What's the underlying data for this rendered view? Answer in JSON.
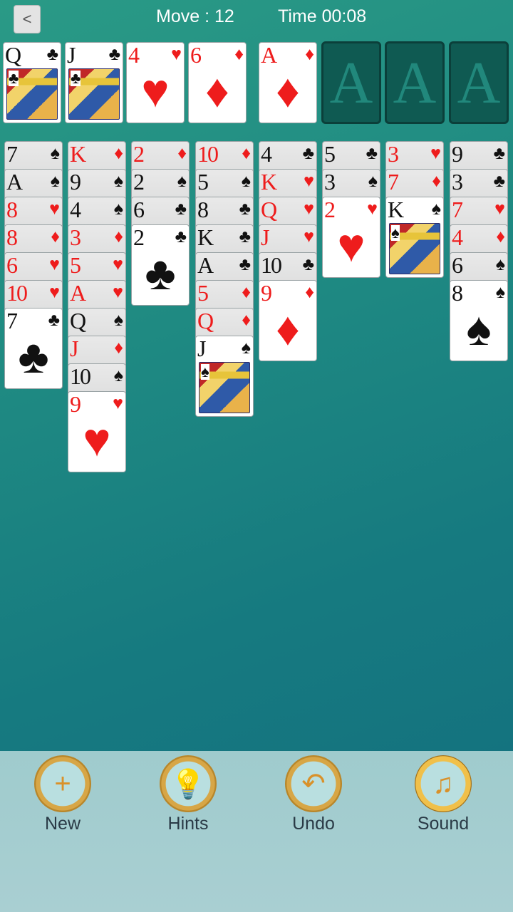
{
  "header": {
    "back_label": "<",
    "move_text": "Move : 12",
    "time_text": "Time 00:08"
  },
  "colors": {
    "red": "#ee1c1c",
    "black": "#111111"
  },
  "free_cells": [
    {
      "rank": "Q",
      "suit": "♣",
      "color": "black",
      "face": true
    },
    {
      "rank": "J",
      "suit": "♣",
      "color": "black",
      "face": true
    },
    {
      "rank": "4",
      "suit": "♥",
      "color": "red",
      "face": false
    },
    {
      "rank": "6",
      "suit": "♦",
      "color": "red",
      "face": false
    }
  ],
  "foundations": [
    {
      "rank": "A",
      "suit": "♦",
      "color": "red",
      "empty": false
    },
    {
      "placeholder": "A",
      "empty": true
    },
    {
      "placeholder": "A",
      "empty": true
    },
    {
      "placeholder": "A",
      "empty": true
    }
  ],
  "tableau": [
    [
      {
        "rank": "7",
        "suit": "♠",
        "color": "black"
      },
      {
        "rank": "A",
        "suit": "♠",
        "color": "black"
      },
      {
        "rank": "8",
        "suit": "♥",
        "color": "red"
      },
      {
        "rank": "8",
        "suit": "♦",
        "color": "red"
      },
      {
        "rank": "6",
        "suit": "♥",
        "color": "red"
      },
      {
        "rank": "10",
        "suit": "♥",
        "color": "red"
      },
      {
        "rank": "7",
        "suit": "♣",
        "color": "black"
      }
    ],
    [
      {
        "rank": "K",
        "suit": "♦",
        "color": "red"
      },
      {
        "rank": "9",
        "suit": "♠",
        "color": "black"
      },
      {
        "rank": "4",
        "suit": "♠",
        "color": "black"
      },
      {
        "rank": "3",
        "suit": "♦",
        "color": "red"
      },
      {
        "rank": "5",
        "suit": "♥",
        "color": "red"
      },
      {
        "rank": "A",
        "suit": "♥",
        "color": "red"
      },
      {
        "rank": "Q",
        "suit": "♠",
        "color": "black"
      },
      {
        "rank": "J",
        "suit": "♦",
        "color": "red"
      },
      {
        "rank": "10",
        "suit": "♠",
        "color": "black"
      },
      {
        "rank": "9",
        "suit": "♥",
        "color": "red"
      }
    ],
    [
      {
        "rank": "2",
        "suit": "♦",
        "color": "red"
      },
      {
        "rank": "2",
        "suit": "♠",
        "color": "black"
      },
      {
        "rank": "6",
        "suit": "♣",
        "color": "black"
      },
      {
        "rank": "2",
        "suit": "♣",
        "color": "black"
      }
    ],
    [
      {
        "rank": "10",
        "suit": "♦",
        "color": "red"
      },
      {
        "rank": "5",
        "suit": "♠",
        "color": "black"
      },
      {
        "rank": "8",
        "suit": "♣",
        "color": "black"
      },
      {
        "rank": "K",
        "suit": "♣",
        "color": "black"
      },
      {
        "rank": "A",
        "suit": "♣",
        "color": "black"
      },
      {
        "rank": "5",
        "suit": "♦",
        "color": "red"
      },
      {
        "rank": "Q",
        "suit": "♦",
        "color": "red"
      },
      {
        "rank": "J",
        "suit": "♠",
        "color": "black",
        "face": true
      }
    ],
    [
      {
        "rank": "4",
        "suit": "♣",
        "color": "black"
      },
      {
        "rank": "K",
        "suit": "♥",
        "color": "red"
      },
      {
        "rank": "Q",
        "suit": "♥",
        "color": "red"
      },
      {
        "rank": "J",
        "suit": "♥",
        "color": "red"
      },
      {
        "rank": "10",
        "suit": "♣",
        "color": "black"
      },
      {
        "rank": "9",
        "suit": "♦",
        "color": "red"
      }
    ],
    [
      {
        "rank": "5",
        "suit": "♣",
        "color": "black"
      },
      {
        "rank": "3",
        "suit": "♠",
        "color": "black"
      },
      {
        "rank": "2",
        "suit": "♥",
        "color": "red"
      }
    ],
    [
      {
        "rank": "3",
        "suit": "♥",
        "color": "red"
      },
      {
        "rank": "7",
        "suit": "♦",
        "color": "red"
      },
      {
        "rank": "K",
        "suit": "♠",
        "color": "black",
        "face": true
      }
    ],
    [
      {
        "rank": "9",
        "suit": "♣",
        "color": "black"
      },
      {
        "rank": "3",
        "suit": "♣",
        "color": "black"
      },
      {
        "rank": "7",
        "suit": "♥",
        "color": "red"
      },
      {
        "rank": "4",
        "suit": "♦",
        "color": "red"
      },
      {
        "rank": "6",
        "suit": "♠",
        "color": "black"
      },
      {
        "rank": "8",
        "suit": "♠",
        "color": "black"
      }
    ]
  ],
  "toolbar": [
    {
      "id": "new",
      "label": "New",
      "icon": "plus-icon",
      "glyph": "+"
    },
    {
      "id": "hints",
      "label": "Hints",
      "icon": "lightbulb-icon",
      "glyph": "💡"
    },
    {
      "id": "undo",
      "label": "Undo",
      "icon": "undo-arrow-icon",
      "glyph": "↶"
    },
    {
      "id": "sound",
      "label": "Sound",
      "icon": "music-note-icon",
      "glyph": "♫",
      "active": true
    }
  ]
}
